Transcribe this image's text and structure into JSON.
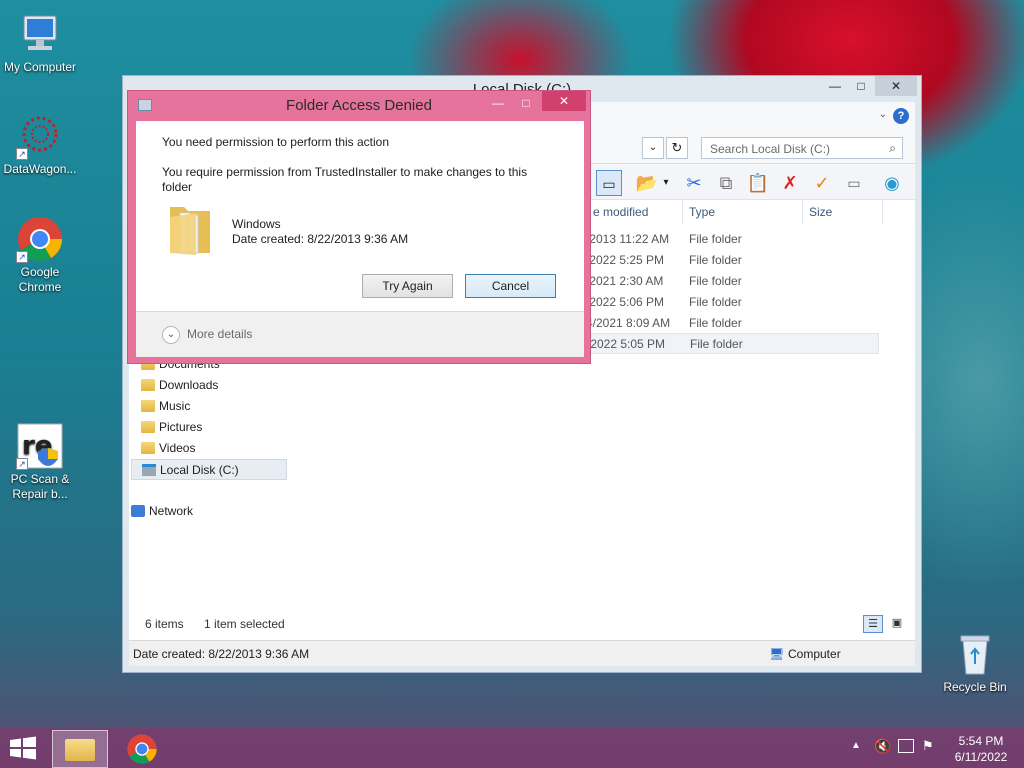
{
  "desktop": {
    "icons": [
      {
        "label": "My Computer"
      },
      {
        "label": "DataWagon..."
      },
      {
        "label": "Google Chrome"
      },
      {
        "label": "PC Scan & Repair b..."
      },
      {
        "label": "Recycle Bin"
      }
    ]
  },
  "explorer": {
    "title": "Local Disk (C:)",
    "search_placeholder": "Search Local Disk (C:)",
    "columns": {
      "modified": "e modified",
      "type": "Type",
      "size": "Size"
    },
    "rows": [
      {
        "modified": "/2013 11:22 AM",
        "type": "File folder"
      },
      {
        "modified": "/2022 5:25 PM",
        "type": "File folder"
      },
      {
        "modified": "/2021 2:30 AM",
        "type": "File folder"
      },
      {
        "modified": "/2022 5:06 PM",
        "type": "File folder"
      },
      {
        "modified": "4/2021 8:09 AM",
        "type": "File folder"
      },
      {
        "modified": "/2022 5:05 PM",
        "type": "File folder"
      }
    ],
    "nav": [
      {
        "label": "Documents"
      },
      {
        "label": "Downloads"
      },
      {
        "label": "Music"
      },
      {
        "label": "Pictures"
      },
      {
        "label": "Videos"
      },
      {
        "label": "Local Disk (C:)"
      },
      {
        "label": "Network"
      }
    ],
    "status": {
      "items": "6 items",
      "selected": "1 item selected",
      "date_created": "Date created: 8/22/2013 9:36 AM",
      "location": "Computer"
    }
  },
  "dialog": {
    "title": "Folder Access Denied",
    "heading": "You need permission to perform this action",
    "message": "You require permission from TrustedInstaller to make changes to this folder",
    "folder_name": "Windows",
    "folder_date": "Date created: 8/22/2013 9:36 AM",
    "try_again": "Try Again",
    "cancel": "Cancel",
    "more_details": "More details"
  },
  "taskbar": {
    "time": "5:54 PM",
    "date": "6/11/2022"
  }
}
